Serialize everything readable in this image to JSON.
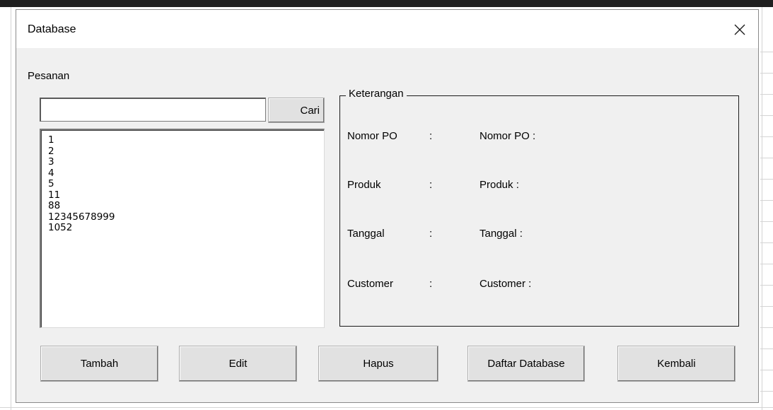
{
  "window": {
    "title": "Database"
  },
  "search": {
    "section_label": "Pesanan",
    "value": "",
    "button_label": "Cari"
  },
  "list": {
    "items": [
      "1",
      "2",
      "3",
      "4",
      "5",
      "11",
      "88",
      "12345678999",
      "1052"
    ]
  },
  "details": {
    "group_label": "Keterangan",
    "rows": [
      {
        "label": "Nomor PO",
        "colon": ":",
        "value": "Nomor PO :"
      },
      {
        "label": "Produk",
        "colon": ":",
        "value": "Produk :"
      },
      {
        "label": "Tanggal",
        "colon": ":",
        "value": "Tanggal :"
      },
      {
        "label": "Customer",
        "colon": ":",
        "value": "Customer :"
      }
    ]
  },
  "buttons": {
    "tambah": "Tambah",
    "edit": "Edit",
    "hapus": "Hapus",
    "daftar": "Daftar Database",
    "kembali": "Kembali"
  },
  "icons": {
    "close": "close-icon"
  },
  "colors": {
    "dialog_bg": "#f0f0f0",
    "titlebar_bg": "#ffffff",
    "button_bg": "#e1e1e1"
  }
}
